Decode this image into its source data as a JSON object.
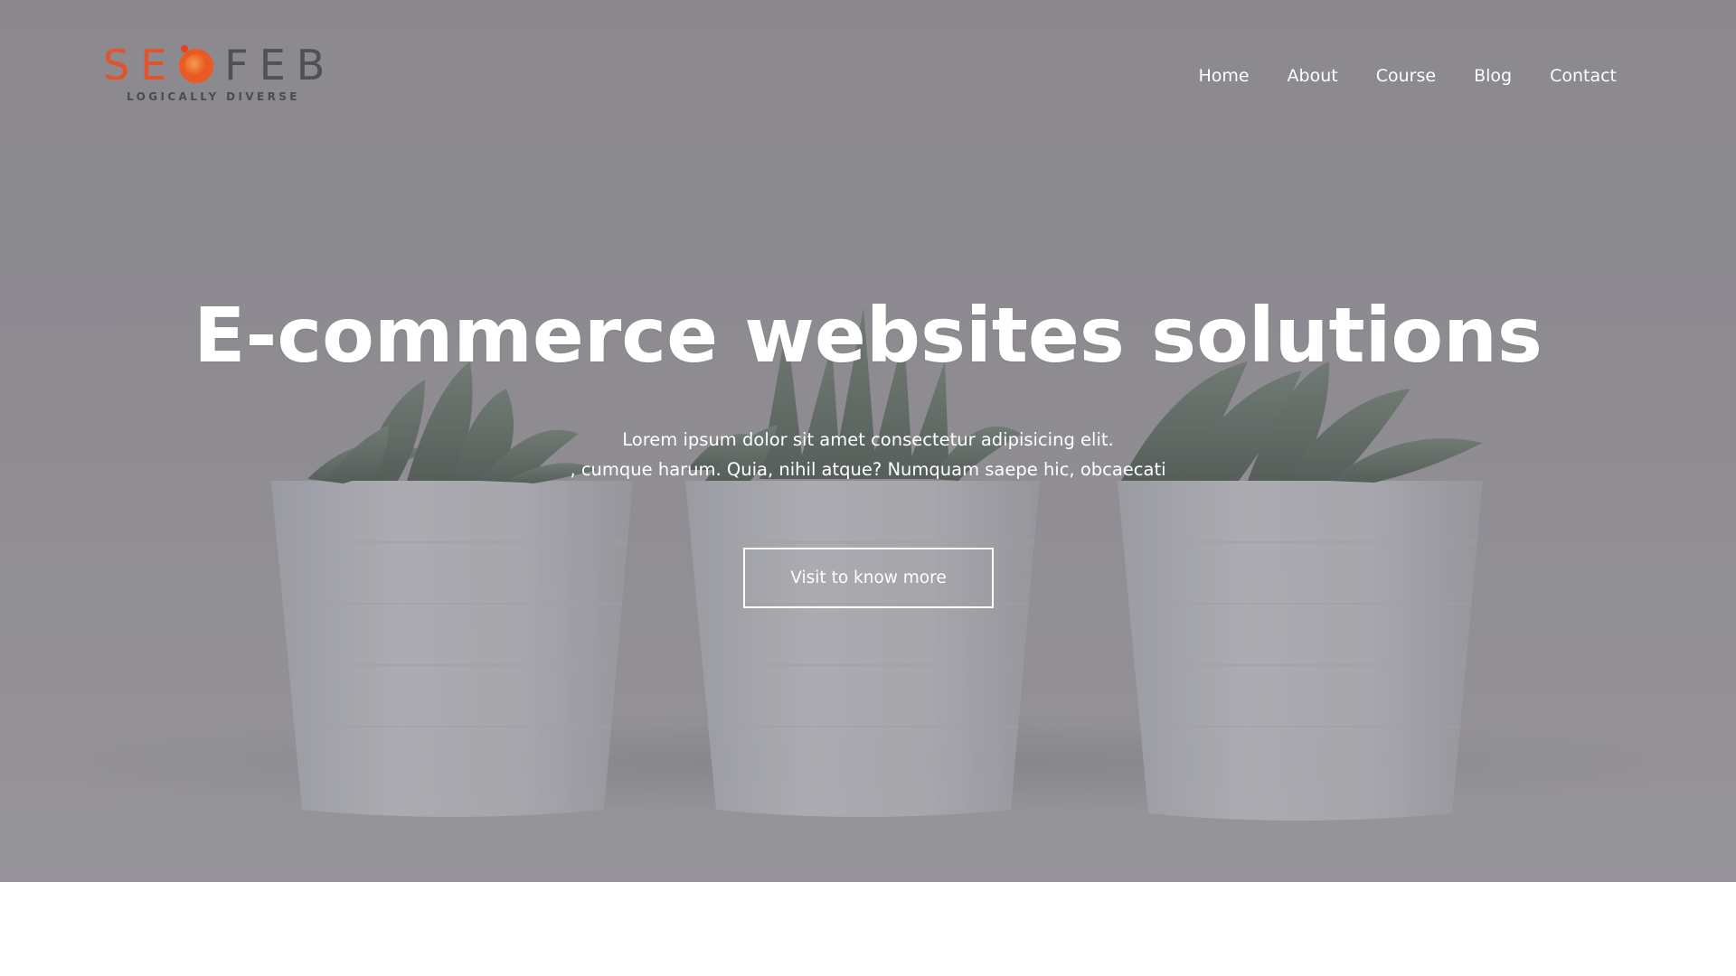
{
  "brand": {
    "logo_letters_left": "SE",
    "logo_letters_right": "FEB",
    "tagline": "LOGICALLY DIVERSE",
    "colors": {
      "orange": "#e95a22",
      "gray": "#525057"
    }
  },
  "nav": {
    "items": [
      {
        "label": "Home"
      },
      {
        "label": "About"
      },
      {
        "label": "Course"
      },
      {
        "label": "Blog"
      },
      {
        "label": "Contact"
      }
    ]
  },
  "hero": {
    "headline": "E-commerce websites solutions",
    "subtext_line1": "Lorem ipsum dolor sit amet consectetur adipisicing elit.",
    "subtext_line2": ", cumque harum. Quia, nihil atque? Numquam saepe hic, obcaecati",
    "cta_label": "Visit to know more",
    "background_image": "three potted succulents in white pots",
    "overlay_color": "#8f8e93"
  }
}
